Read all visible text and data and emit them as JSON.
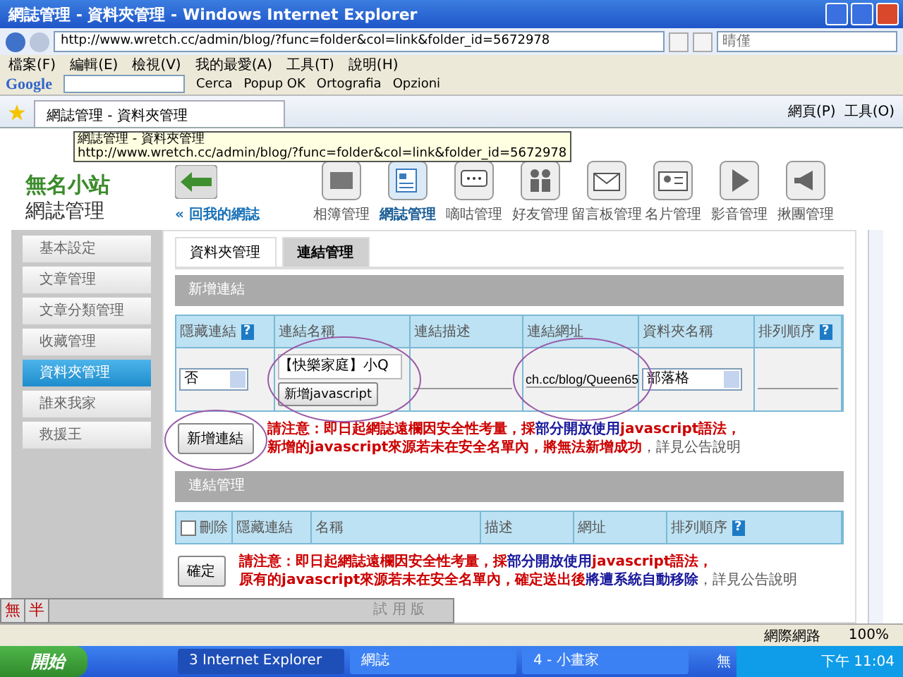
{
  "window": {
    "title": "網誌管理 - 資料夾管理 - Windows Internet Explorer"
  },
  "address_bar": {
    "url": "http://www.wretch.cc/admin/blog/?func=folder&col=link&folder_id=5672978",
    "search_placeholder": "晴僅"
  },
  "menu_bar": [
    "檔案(F)",
    "編輯(E)",
    "檢視(V)",
    "我的最愛(A)",
    "工具(T)",
    "說明(H)"
  ],
  "google_toolbar": {
    "logo": "Google",
    "items": [
      "Cerca",
      "Popup OK",
      "Ortografia",
      "Opzioni"
    ]
  },
  "tab_bar": {
    "tabs": [
      {
        "label": "網誌管理 - 資料夾管理",
        "selected": true
      }
    ],
    "tools": [
      "網頁(P)",
      "工具(O)"
    ]
  },
  "tooltip": {
    "title": "網誌管理 - 資料夾管理",
    "url": "http://www.wretch.cc/admin/blog/?func=folder&col=link&folder_id=5672978"
  },
  "site": {
    "logo": "無名小站",
    "heading": "網誌管理",
    "back_link": "« 回我的網誌"
  },
  "nav": [
    {
      "label": "相簿管理",
      "kind": "photo",
      "selected": false
    },
    {
      "label": "網誌管理",
      "kind": "document",
      "selected": true
    },
    {
      "label": "嘀咕管理",
      "kind": "chat",
      "selected": false
    },
    {
      "label": "好友管理",
      "kind": "people",
      "selected": false
    },
    {
      "label": "留言板管理",
      "kind": "envelope",
      "selected": false
    },
    {
      "label": "名片管理",
      "kind": "card",
      "selected": false
    },
    {
      "label": "影音管理",
      "kind": "play",
      "selected": false
    },
    {
      "label": "揪團管理",
      "kind": "megaphone",
      "selected": false
    }
  ],
  "sidebar": {
    "items": [
      {
        "label": "基本設定",
        "selected": false
      },
      {
        "label": "文章管理",
        "selected": false
      },
      {
        "label": "文章分類管理",
        "selected": false
      },
      {
        "label": "收藏管理",
        "selected": false
      },
      {
        "label": "資料夾管理",
        "selected": true
      },
      {
        "label": "誰來我家",
        "selected": false
      },
      {
        "label": "救援王",
        "selected": false
      }
    ]
  },
  "tabs": [
    {
      "label": "資料夾管理",
      "selected": false
    },
    {
      "label": "連結管理",
      "selected": true
    }
  ],
  "add_section": {
    "title": "新增連結",
    "columns": [
      {
        "label": "隱藏連結",
        "help": "?"
      },
      {
        "label": "連結名稱"
      },
      {
        "label": "連結描述"
      },
      {
        "label": "連結網址"
      },
      {
        "label": "資料夾名稱"
      },
      {
        "label": "排列順序",
        "help": "?"
      }
    ],
    "row": {
      "hidden": "否",
      "name": "【快樂家庭】小Q",
      "js_button": "新增javascript",
      "url": "ch.cc/blog/Queen65",
      "folder": "部落格"
    },
    "submit": "新增連結",
    "notice": [
      [
        {
          "kind": "alert",
          "text": "請注意：即日起網誌遠欄因安全性考量，採"
        },
        {
          "kind": "highlight",
          "text": "部分開放使用"
        },
        {
          "kind": "alert",
          "text": "javascript語法，"
        }
      ],
      [
        {
          "kind": "alert",
          "text": "新增的javascript來源若未在安全名單內，將無法新增成功"
        },
        {
          "kind": "plain",
          "text": "，詳見公告說明"
        }
      ]
    ]
  },
  "manage_section": {
    "title": "連結管理",
    "columns": [
      {
        "label": "刪除",
        "checkbox": false
      },
      {
        "label": "隱藏連結"
      },
      {
        "label": "名稱"
      },
      {
        "label": "描述"
      },
      {
        "label": "網址"
      },
      {
        "label": "排列順序",
        "help": "?"
      }
    ],
    "submit": "確定",
    "notice": [
      [
        {
          "kind": "alert",
          "text": "請注意：即日起網誌遠欄因安全性考量，採"
        },
        {
          "kind": "highlight",
          "text": "部分開放使用"
        },
        {
          "kind": "alert",
          "text": "javascript語法，"
        }
      ],
      [
        {
          "kind": "alert",
          "text": "原有的javascript來源若未在安全名單內，確定送出後"
        },
        {
          "kind": "highlight",
          "text": "將遭系統自動移除"
        },
        {
          "kind": "plain",
          "text": "，詳見公告說明"
        }
      ]
    ]
  },
  "ime_bar": {
    "keys": [
      "無",
      "半"
    ],
    "label": "試 用 版"
  },
  "status_bar": {
    "zone": "網際網路",
    "zoom": "100%"
  },
  "taskbar": {
    "start": "開始",
    "tasks": [
      {
        "label": "3 Internet Explorer",
        "selected": true
      },
      {
        "label": "網誌",
        "selected": false
      },
      {
        "label": "4 - 小畫家",
        "selected": false
      }
    ],
    "ime": "無",
    "clock": "下午 11:04"
  }
}
